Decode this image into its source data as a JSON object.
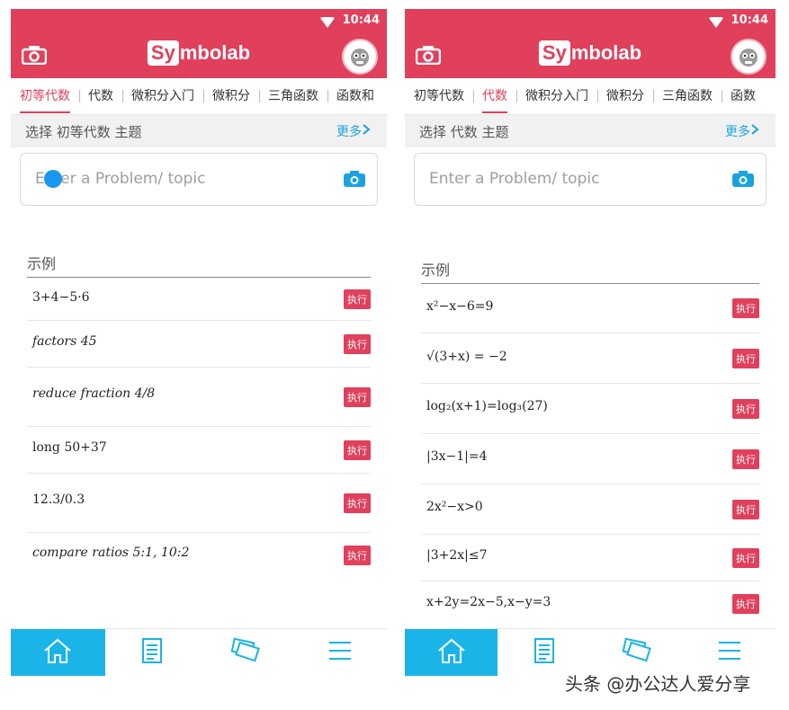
{
  "status": {
    "time": "10:44"
  },
  "brand": {
    "logo_sy": "Sy",
    "logo_rest": "mbolab",
    "accent": "#e0405b",
    "link": "#1aa3de",
    "nav_active": "#1ab4e8"
  },
  "icons": {
    "camera": "camera-icon",
    "wifi": "wifi-icon",
    "home": "home-icon",
    "notes": "notes-icon",
    "cards": "cards-icon",
    "menu": "menu-icon",
    "chevron": "chevron-right-icon"
  },
  "phone1": {
    "tabs": [
      "初等代数",
      "代数",
      "微积分入门",
      "微积分",
      "三角函数",
      "函数和"
    ],
    "active_tab": 0,
    "topic": "选择 初等代数 主题",
    "more": "更多",
    "search_placeholder": "Enter a Problem/ topic",
    "examples_header": "示例",
    "run_label": "执行",
    "examples": [
      "3+4−5·6",
      "factors 45",
      "reduce fraction 4/8",
      "long 50+37",
      "12.3/0.3",
      "compare ratios 5:1, 10:2"
    ]
  },
  "phone2": {
    "tabs": [
      "初等代数",
      "代数",
      "微积分入门",
      "微积分",
      "三角函数",
      "函数"
    ],
    "active_tab": 1,
    "topic": "选择 代数 主题",
    "more": "更多",
    "search_placeholder": "Enter a Problem/ topic",
    "examples_header": "示例",
    "run_label": "执行",
    "examples": [
      "x²−x−6=9",
      "√(3+x) = −2",
      "log₂(x+1)=log₃(27)",
      "|3x−1|=4",
      "2x²−x>0",
      "|3+2x|≤7",
      "x+2y=2x−5,x−y=3"
    ]
  },
  "watermark": "头条 @办公达人爱分享"
}
